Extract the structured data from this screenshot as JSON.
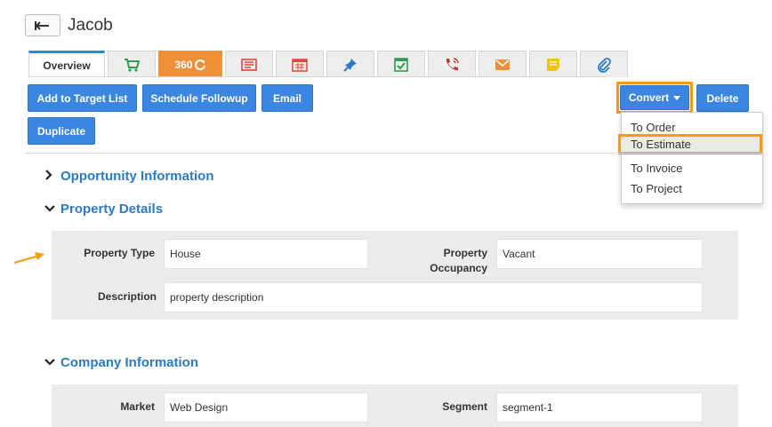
{
  "header": {
    "title": "Jacob",
    "back_icon": "arrow-left-icon"
  },
  "tabs": [
    {
      "label": "Overview",
      "icon": "overview"
    },
    {
      "icon": "cart-icon",
      "color": "#2e9e4f"
    },
    {
      "label": "360",
      "icon": "refresh-icon",
      "color": "#f0913a"
    },
    {
      "icon": "invoice-icon",
      "color": "#e0473a"
    },
    {
      "icon": "calendar-icon",
      "color": "#e0473a"
    },
    {
      "icon": "pin-icon",
      "color": "#2a7bc4"
    },
    {
      "icon": "checklist-icon",
      "color": "#2e9e4f"
    },
    {
      "icon": "phone-icon",
      "color": "#c0392b"
    },
    {
      "icon": "mail-icon",
      "color": "#f0913a"
    },
    {
      "icon": "note-icon",
      "color": "#f1c40f"
    },
    {
      "icon": "paperclip-icon",
      "color": "#2a7bc4"
    }
  ],
  "toolbar": {
    "add_to_target_list": "Add to Target List",
    "schedule_followup": "Schedule Followup",
    "email": "Email",
    "duplicate": "Duplicate",
    "convert": "Convert",
    "delete": "Delete"
  },
  "convert_menu": {
    "items": [
      "To Order",
      "To Estimate",
      "To Invoice",
      "To Project"
    ],
    "highlighted": "To Estimate"
  },
  "sections": {
    "opportunity": {
      "title": "Opportunity Information",
      "collapsed": true
    },
    "property": {
      "title": "Property Details",
      "collapsed": false,
      "property_type_label": "Property Type",
      "property_type_value": "House",
      "occupancy_label_line1": "Property",
      "occupancy_label_line2": "Occupancy",
      "occupancy_value": "Vacant",
      "description_label": "Description",
      "description_value": "property description"
    },
    "company": {
      "title": "Company Information",
      "collapsed": false,
      "market_label": "Market",
      "market_value": "Web Design",
      "segment_label": "Segment",
      "segment_value": "segment-1"
    }
  },
  "colors": {
    "accent": "#3b86e0",
    "highlight": "#f39c12",
    "section_title": "#2a7bc4"
  }
}
